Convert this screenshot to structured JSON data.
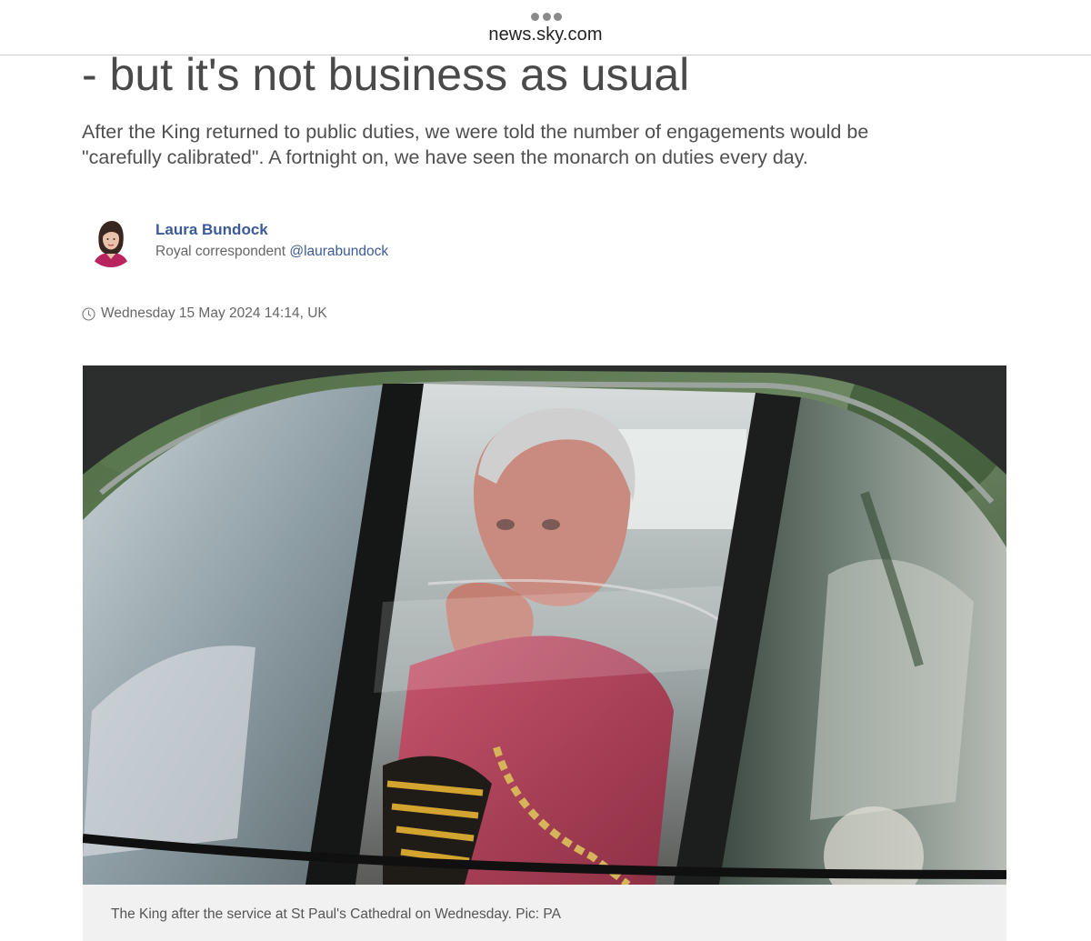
{
  "browser": {
    "url": "news.sky.com",
    "menu_icon": "ellipsis-icon"
  },
  "article": {
    "headline": "- but it's not business as usual",
    "standfirst": "After the King returned to public duties, we were told the number of engagements would be \"carefully calibrated\". A fortnight on, we have seen the monarch on duties every day.",
    "author": {
      "name": "Laura Bundock",
      "role": "Royal correspondent ",
      "handle": "@laurabundock"
    },
    "timestamp": "Wednesday 15 May 2024 14:14, UK",
    "timestamp_icon": "clock-icon",
    "image": {
      "caption": "The King after the service at St Paul's Cathedral on Wednesday. Pic: PA"
    }
  },
  "colors": {
    "link": "#3c5a98",
    "headline": "#4a4a4a",
    "caption_bg": "#f1f1f1"
  }
}
